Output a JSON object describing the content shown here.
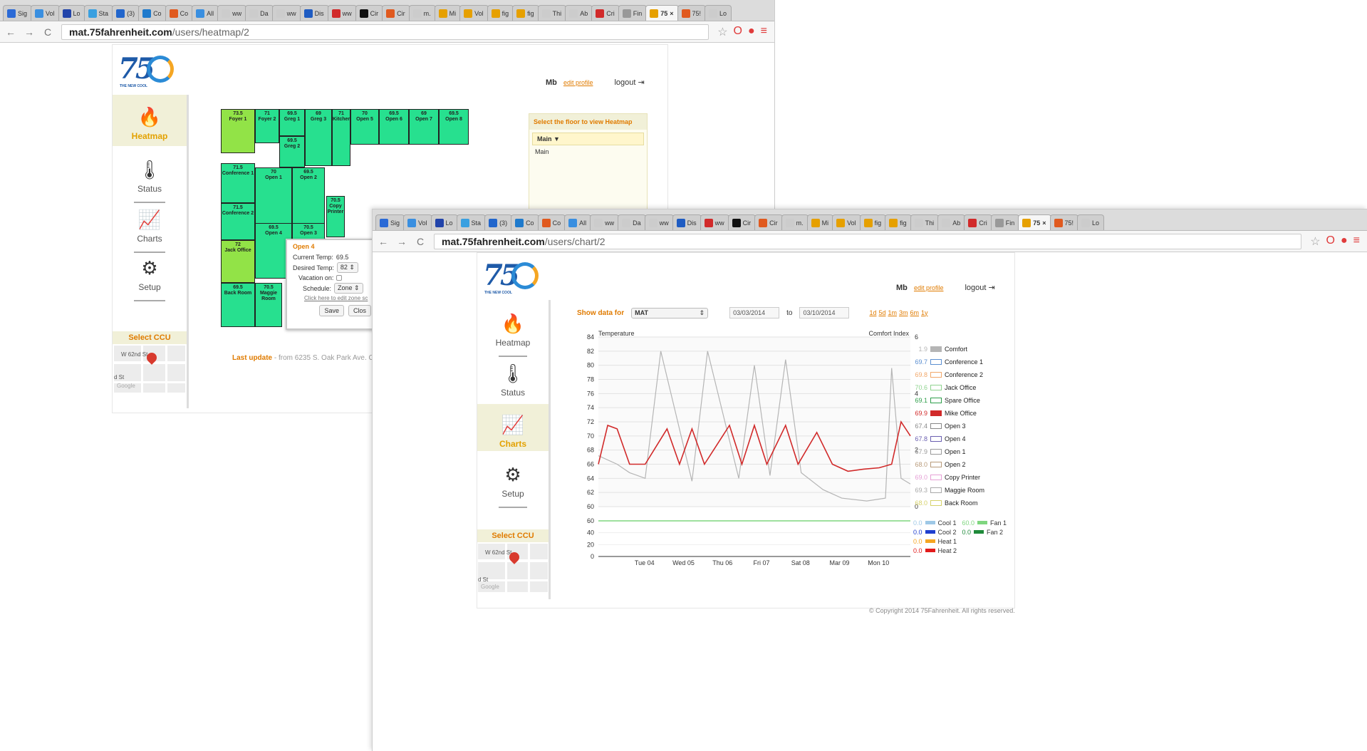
{
  "back_window": {
    "tabs": [
      "Sig",
      "Vol",
      "Lo",
      "Sta",
      "(3)",
      "Co",
      "Co",
      "All",
      "ww",
      "Da",
      "ww",
      "Dis",
      "ww",
      "Cir",
      "Cir",
      "m.",
      "Mi",
      "Vol",
      "fig",
      "fig",
      "Thi",
      "Ab",
      "Cri",
      "Fin",
      "75",
      "75!",
      "Lo"
    ],
    "active_tab": 24,
    "url_host": "mat.75fahrenheit.com",
    "url_path": "/users/heatmap/2"
  },
  "front_window": {
    "tabs": [
      "Sig",
      "Vol",
      "Lo",
      "Sta",
      "(3)",
      "Co",
      "Co",
      "All",
      "ww",
      "Da",
      "ww",
      "Dis",
      "ww",
      "Cir",
      "Cir",
      "m.",
      "Mi",
      "Vol",
      "fig",
      "fig",
      "Thi",
      "Ab",
      "Cri",
      "Fin",
      "75",
      "75!",
      "Lo"
    ],
    "active_tab": 24,
    "url_host": "mat.75fahrenheit.com",
    "url_path": "/users/chart/2"
  },
  "brand": {
    "logo_text": "75",
    "tagline": "THE NEW COOL"
  },
  "user": {
    "name": "Mb",
    "edit_profile": "edit profile",
    "logout": "logout"
  },
  "nav": {
    "heatmap": "Heatmap",
    "status": "Status",
    "charts": "Charts",
    "setup": "Setup",
    "select_ccu": "Select CCU"
  },
  "map": {
    "street1": "W 62nd St",
    "street2": "d St",
    "google": "Google"
  },
  "heatmap": {
    "zones": [
      {
        "name": "Foyer 1",
        "temp": "73.5"
      },
      {
        "name": "Foyer 2",
        "temp": "71"
      },
      {
        "name": "Greg 1",
        "temp": "69.5"
      },
      {
        "name": "Greg 3",
        "temp": "69"
      },
      {
        "name": "Kitchen",
        "temp": "71"
      },
      {
        "name": "Open 5",
        "temp": "70"
      },
      {
        "name": "Open 6",
        "temp": "69.5"
      },
      {
        "name": "Open 7",
        "temp": "69"
      },
      {
        "name": "Open 8",
        "temp": "69.5"
      },
      {
        "name": "Greg 2",
        "temp": "69.5"
      },
      {
        "name": "Conference 1",
        "temp": "71.5"
      },
      {
        "name": "Open 1",
        "temp": "70"
      },
      {
        "name": "Open 2",
        "temp": "69.5"
      },
      {
        "name": "Copy Printer",
        "temp": "70.5"
      },
      {
        "name": "Conference 2",
        "temp": "71.5"
      },
      {
        "name": "Open 4",
        "temp": "69.5"
      },
      {
        "name": "Open 3",
        "temp": "70.5"
      },
      {
        "name": "Jack Office",
        "temp": "72"
      },
      {
        "name": "Back Room",
        "temp": "69.5"
      },
      {
        "name": "Maggie Room",
        "temp": "70.5"
      }
    ],
    "floor_panel": {
      "title": "Select the floor to view Heatmap",
      "selected": "Main",
      "options": [
        "Main"
      ]
    },
    "popup": {
      "title": "Open 4",
      "current_label": "Current Temp:",
      "current_value": "69.5",
      "desired_label": "Desired Temp:",
      "desired_value": "82",
      "vacation_label": "Vacation on:",
      "schedule_label": "Schedule:",
      "schedule_value": "Zone",
      "edit_link": "Click here to edit zone sc",
      "save": "Save",
      "close": "Clos"
    },
    "last_update_label": "Last update",
    "last_update_text": " - from 6235 S. Oak Park Ave. Chi"
  },
  "chart_controls": {
    "show_label": "Show data for",
    "show_value": "MAT",
    "from": "03/03/2014",
    "to_label": "to",
    "to": "03/10/2014",
    "ranges": [
      "1d",
      "5d",
      "1m",
      "3m",
      "6m",
      "1y"
    ]
  },
  "chart_data": [
    {
      "type": "line",
      "ylabel": "Temperature",
      "y2label": "Comfort Index",
      "ylim": [
        60,
        84
      ],
      "yticks": [
        "84",
        "82",
        "80",
        "78",
        "76",
        "74",
        "72",
        "70",
        "68",
        "66",
        "64",
        "62",
        "60"
      ],
      "y2lim": [
        0,
        6
      ],
      "y2ticks": [
        "6",
        "4",
        "2",
        "0"
      ],
      "x_ticks": [
        "Tue 04",
        "Wed 05",
        "Thu 06",
        "Fri 07",
        "Sat 08",
        "Mar 09",
        "Mon 10"
      ],
      "series": [
        {
          "name": "Comfort",
          "color": "#b5b5b5",
          "value": "1.9",
          "t": [
            0,
            0.06,
            0.1,
            0.15,
            0.2,
            0.3,
            0.35,
            0.45,
            0.5,
            0.55,
            0.6,
            0.65,
            0.72,
            0.78,
            0.86,
            0.92,
            0.94,
            0.97,
            1.0
          ],
          "v": [
            1.8,
            1.5,
            1.2,
            1.0,
            5.5,
            0.9,
            5.5,
            1.0,
            5.0,
            1.1,
            5.2,
            1.2,
            0.6,
            0.3,
            0.2,
            0.3,
            4.9,
            1.0,
            0.8
          ]
        },
        {
          "name": "Mike Office",
          "color": "#d12a2a",
          "value": "69.9",
          "t": [
            0,
            0.03,
            0.06,
            0.1,
            0.15,
            0.22,
            0.26,
            0.3,
            0.34,
            0.42,
            0.46,
            0.5,
            0.54,
            0.6,
            0.64,
            0.7,
            0.75,
            0.8,
            0.85,
            0.9,
            0.94,
            0.97,
            1.0
          ],
          "v": [
            66,
            71.5,
            71,
            66,
            66,
            71,
            66,
            71,
            66,
            71.5,
            66,
            71.5,
            66,
            71.5,
            66,
            70.5,
            66,
            65,
            65.3,
            65.5,
            66,
            72,
            70
          ]
        }
      ],
      "legend": [
        {
          "value": "1.9",
          "name": "Comfort",
          "color": "#b5b5b5",
          "fill": true
        },
        {
          "value": "69.7",
          "name": "Conference 1",
          "color": "#5b8fd1"
        },
        {
          "value": "69.8",
          "name": "Conference 2",
          "color": "#f2a86a"
        },
        {
          "value": "70.6",
          "name": "Jack Office",
          "color": "#8fd38f"
        },
        {
          "value": "69.1",
          "name": "Spare Office",
          "color": "#2e9e4a"
        },
        {
          "value": "69.9",
          "name": "Mike Office",
          "color": "#d12a2a",
          "fill": true
        },
        {
          "value": "67.4",
          "name": "Open 3",
          "color": "#888888"
        },
        {
          "value": "67.8",
          "name": "Open 4",
          "color": "#6a5fb0"
        },
        {
          "value": "67.9",
          "name": "Open 1",
          "color": "#999999"
        },
        {
          "value": "68.0",
          "name": "Open 2",
          "color": "#b89a7a"
        },
        {
          "value": "69.0",
          "name": "Copy Printer",
          "color": "#e6a0d6"
        },
        {
          "value": "69.3",
          "name": "Maggie Room",
          "color": "#a8a8a8"
        },
        {
          "value": "68.0",
          "name": "Back Room",
          "color": "#d6d26a"
        }
      ]
    },
    {
      "type": "bar",
      "ylim": [
        0,
        60
      ],
      "yticks": [
        "60",
        "40",
        "20",
        "0"
      ],
      "series": [
        {
          "name": "Cool 1",
          "value": "0.0",
          "color": "#9ec8e6"
        },
        {
          "name": "Cool 2",
          "value": "0.0",
          "color": "#1f3fcf"
        },
        {
          "name": "Heat 1",
          "value": "0.0",
          "color": "#f5a623"
        },
        {
          "name": "Heat 2",
          "value": "0.0",
          "color": "#e21b1b"
        },
        {
          "name": "Fan 1",
          "value": "60.0",
          "color": "#7fd67f"
        },
        {
          "name": "Fan 2",
          "value": "0.0",
          "color": "#1f8a3a"
        }
      ]
    }
  ],
  "copyright": "© Copyright 2014 75Fahrenheit. All rights reserved."
}
